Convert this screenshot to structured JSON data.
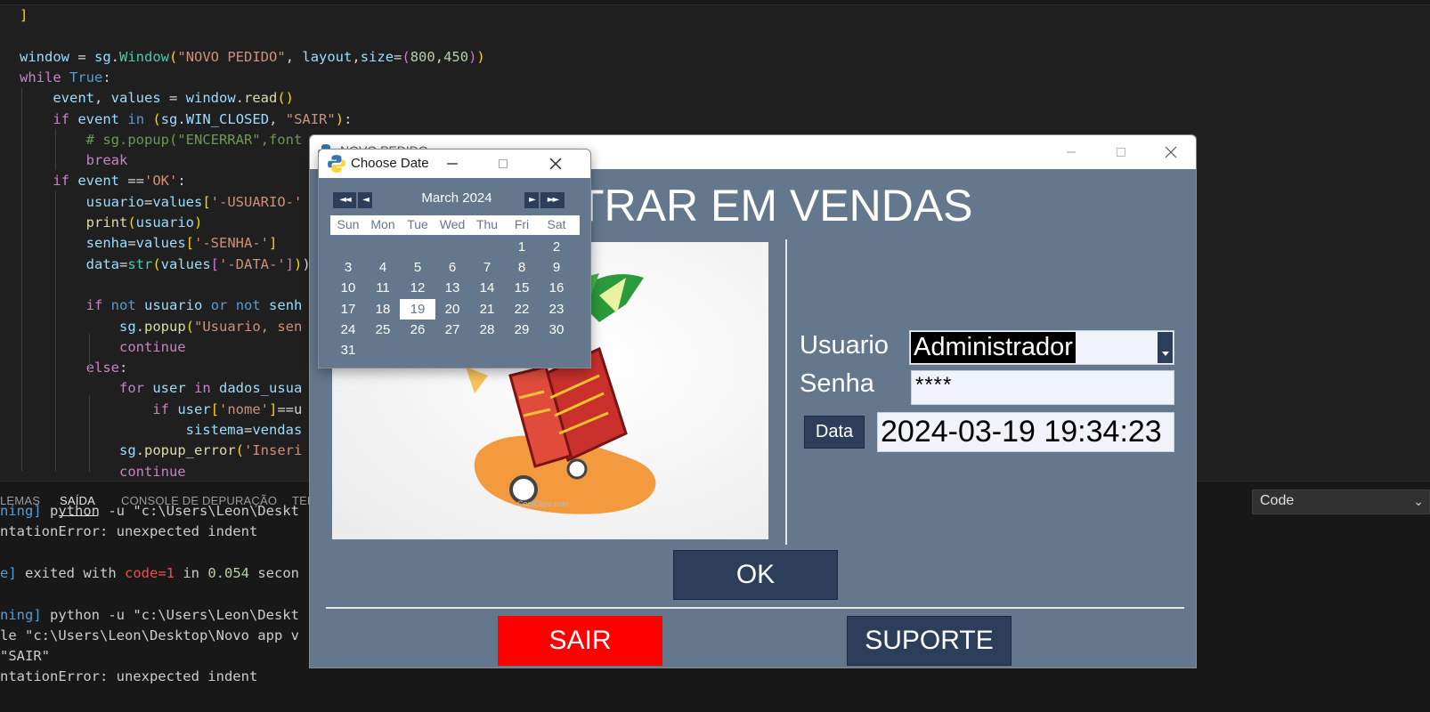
{
  "editor": {
    "lines": [
      [
        {
          "t": "]",
          "c": "tk-bracket"
        }
      ],
      [],
      [
        {
          "t": "window",
          "c": "tk-var"
        },
        {
          "t": " = ",
          "c": "tk-plain"
        },
        {
          "t": "sg",
          "c": "tk-var"
        },
        {
          "t": ".",
          "c": "tk-plain"
        },
        {
          "t": "Window",
          "c": "tk-cls"
        },
        {
          "t": "(",
          "c": "tk-bracket"
        },
        {
          "t": "\"NOVO PEDIDO\"",
          "c": "tk-str"
        },
        {
          "t": ", ",
          "c": "tk-plain"
        },
        {
          "t": "layout",
          "c": "tk-var"
        },
        {
          "t": ",",
          "c": "tk-plain"
        },
        {
          "t": "size",
          "c": "tk-var"
        },
        {
          "t": "=",
          "c": "tk-plain"
        },
        {
          "t": "(",
          "c": "tk-pink"
        },
        {
          "t": "800",
          "c": "tk-num"
        },
        {
          "t": ",",
          "c": "tk-plain"
        },
        {
          "t": "450",
          "c": "tk-num"
        },
        {
          "t": ")",
          "c": "tk-pink"
        },
        {
          "t": ")",
          "c": "tk-bracket"
        }
      ],
      [
        {
          "t": "while",
          "c": "tk-kw"
        },
        {
          "t": " ",
          "c": "tk-plain"
        },
        {
          "t": "True",
          "c": "tk-blue"
        },
        {
          "t": ":",
          "c": "tk-plain"
        }
      ],
      [
        {
          "t": "    event",
          "c": "tk-var"
        },
        {
          "t": ", ",
          "c": "tk-plain"
        },
        {
          "t": "values",
          "c": "tk-var"
        },
        {
          "t": " = ",
          "c": "tk-plain"
        },
        {
          "t": "window",
          "c": "tk-var"
        },
        {
          "t": ".",
          "c": "tk-plain"
        },
        {
          "t": "read",
          "c": "tk-fn"
        },
        {
          "t": "()",
          "c": "tk-bracket"
        }
      ],
      [
        {
          "t": "    if",
          "c": "tk-kw"
        },
        {
          "t": " ",
          "c": "tk-plain"
        },
        {
          "t": "event",
          "c": "tk-var"
        },
        {
          "t": " ",
          "c": "tk-plain"
        },
        {
          "t": "in",
          "c": "tk-blue"
        },
        {
          "t": " ",
          "c": "tk-plain"
        },
        {
          "t": "(",
          "c": "tk-bracket"
        },
        {
          "t": "sg",
          "c": "tk-var"
        },
        {
          "t": ".",
          "c": "tk-plain"
        },
        {
          "t": "WIN_CLOSED",
          "c": "tk-var"
        },
        {
          "t": ", ",
          "c": "tk-plain"
        },
        {
          "t": "\"SAIR\"",
          "c": "tk-str"
        },
        {
          "t": ")",
          "c": "tk-bracket"
        },
        {
          "t": ":",
          "c": "tk-plain"
        }
      ],
      [
        {
          "t": "        # sg.popup(\"ENCERRAR\",font",
          "c": "tk-cm"
        }
      ],
      [
        {
          "t": "        break",
          "c": "tk-kw"
        }
      ],
      [
        {
          "t": "    if",
          "c": "tk-kw"
        },
        {
          "t": " ",
          "c": "tk-plain"
        },
        {
          "t": "event",
          "c": "tk-var"
        },
        {
          "t": " ==",
          "c": "tk-plain"
        },
        {
          "t": "'OK'",
          "c": "tk-str"
        },
        {
          "t": ":",
          "c": "tk-plain"
        }
      ],
      [
        {
          "t": "        usuario",
          "c": "tk-var"
        },
        {
          "t": "=",
          "c": "tk-plain"
        },
        {
          "t": "values",
          "c": "tk-var"
        },
        {
          "t": "[",
          "c": "tk-bracket"
        },
        {
          "t": "'-USUARIO-'",
          "c": "tk-str"
        }
      ],
      [
        {
          "t": "        print",
          "c": "tk-fn"
        },
        {
          "t": "(",
          "c": "tk-bracket"
        },
        {
          "t": "usuario",
          "c": "tk-var"
        },
        {
          "t": ")",
          "c": "tk-bracket"
        }
      ],
      [
        {
          "t": "        senha",
          "c": "tk-var"
        },
        {
          "t": "=",
          "c": "tk-plain"
        },
        {
          "t": "values",
          "c": "tk-var"
        },
        {
          "t": "[",
          "c": "tk-bracket"
        },
        {
          "t": "'-SENHA-'",
          "c": "tk-str"
        },
        {
          "t": "]",
          "c": "tk-bracket"
        }
      ],
      [
        {
          "t": "        data",
          "c": "tk-var"
        },
        {
          "t": "=",
          "c": "tk-plain"
        },
        {
          "t": "str",
          "c": "tk-cls"
        },
        {
          "t": "(",
          "c": "tk-bracket"
        },
        {
          "t": "values",
          "c": "tk-var"
        },
        {
          "t": "[",
          "c": "tk-pink"
        },
        {
          "t": "'-DATA-'",
          "c": "tk-str"
        },
        {
          "t": "]",
          "c": "tk-pink"
        },
        {
          "t": ")",
          "c": "tk-bracket"
        },
        {
          "t": ")",
          "c": "tk-plain"
        }
      ],
      [],
      [
        {
          "t": "        if",
          "c": "tk-kw"
        },
        {
          "t": " ",
          "c": "tk-plain"
        },
        {
          "t": "not",
          "c": "tk-blue"
        },
        {
          "t": " ",
          "c": "tk-plain"
        },
        {
          "t": "usuario",
          "c": "tk-var"
        },
        {
          "t": " ",
          "c": "tk-plain"
        },
        {
          "t": "or",
          "c": "tk-blue"
        },
        {
          "t": " ",
          "c": "tk-plain"
        },
        {
          "t": "not",
          "c": "tk-blue"
        },
        {
          "t": " ",
          "c": "tk-plain"
        },
        {
          "t": "senh",
          "c": "tk-var"
        }
      ],
      [
        {
          "t": "            sg",
          "c": "tk-var"
        },
        {
          "t": ".",
          "c": "tk-plain"
        },
        {
          "t": "popup",
          "c": "tk-fn"
        },
        {
          "t": "(",
          "c": "tk-bracket"
        },
        {
          "t": "\"Usuario, sen",
          "c": "tk-str"
        }
      ],
      [
        {
          "t": "            continue",
          "c": "tk-kw"
        }
      ],
      [
        {
          "t": "        else",
          "c": "tk-kw"
        },
        {
          "t": ":",
          "c": "tk-plain"
        }
      ],
      [
        {
          "t": "            for",
          "c": "tk-kw"
        },
        {
          "t": " ",
          "c": "tk-plain"
        },
        {
          "t": "user",
          "c": "tk-var"
        },
        {
          "t": " ",
          "c": "tk-plain"
        },
        {
          "t": "in",
          "c": "tk-kw"
        },
        {
          "t": " ",
          "c": "tk-plain"
        },
        {
          "t": "dados_usua",
          "c": "tk-var"
        }
      ],
      [
        {
          "t": "                if",
          "c": "tk-kw"
        },
        {
          "t": " ",
          "c": "tk-plain"
        },
        {
          "t": "user",
          "c": "tk-var"
        },
        {
          "t": "[",
          "c": "tk-bracket"
        },
        {
          "t": "'nome'",
          "c": "tk-str"
        },
        {
          "t": "]",
          "c": "tk-bracket"
        },
        {
          "t": "==u",
          "c": "tk-plain"
        }
      ],
      [
        {
          "t": "                    sistema",
          "c": "tk-var"
        },
        {
          "t": "=",
          "c": "tk-plain"
        },
        {
          "t": "vendas",
          "c": "tk-var"
        }
      ],
      [
        {
          "t": "            sg",
          "c": "tk-var"
        },
        {
          "t": ".",
          "c": "tk-plain"
        },
        {
          "t": "popup_error",
          "c": "tk-fn"
        },
        {
          "t": "(",
          "c": "tk-bracket"
        },
        {
          "t": "'Inseri",
          "c": "tk-str"
        }
      ],
      [
        {
          "t": "            continue",
          "c": "tk-kw"
        }
      ]
    ]
  },
  "panel": {
    "tabs": [
      "LEMAS",
      "SAÍDA",
      "CONSOLE DE DEPURAÇÃO",
      "TER"
    ],
    "active_tab": "SAÍDA",
    "output": [
      [
        {
          "t": "ning]",
          "c": "out-blue"
        },
        {
          "t": " python -u \"c:\\Users\\Leon\\Deskt",
          "c": ""
        }
      ],
      [
        {
          "t": "ntationError: unexpected indent",
          "c": ""
        }
      ],
      [],
      [
        {
          "t": "e]",
          "c": "out-blue"
        },
        {
          "t": " exited with ",
          "c": ""
        },
        {
          "t": "code=1",
          "c": "out-red"
        },
        {
          "t": " in ",
          "c": ""
        },
        {
          "t": "0.054",
          "c": "out-num"
        },
        {
          "t": " secon",
          "c": ""
        }
      ],
      [],
      [
        {
          "t": "ning]",
          "c": "out-blue"
        },
        {
          "t": " python -u \"c:\\Users\\Leon\\Deskt",
          "c": ""
        }
      ],
      [
        {
          "t": "le \"c:\\Users\\Leon\\Desktop\\Novo app v",
          "c": ""
        }
      ],
      [
        {
          "t": "\"SAIR\"",
          "c": ""
        }
      ],
      [
        {
          "t": "ntationError: unexpected indent",
          "c": ""
        }
      ]
    ],
    "dropdown_value": "Code"
  },
  "main_window": {
    "title": "NOVO PEDIDO",
    "heading": "TRAR EM VENDAS",
    "usuario_label": "Usuario",
    "usuario_value": "Administrador",
    "senha_label": "Senha",
    "senha_value": "****",
    "data_button": "Data",
    "data_value": "2024-03-19 19:34:23",
    "ok_button": "OK",
    "sair_button": "SAIR",
    "suporte_button": "SUPORTE",
    "image_caption": "CoolClips.com",
    "colors": {
      "background": "#64778d",
      "button": "#2c3e5a",
      "exit": "#ff0000"
    }
  },
  "date_popup": {
    "title": "Choose Date",
    "month_label": "March 2024",
    "prev_year": "◄◄",
    "prev_month": "◄",
    "next_month": "►",
    "next_year": "►►",
    "weekdays": [
      "Sun",
      "Mon",
      "Tue",
      "Wed",
      "Thu",
      "Fri",
      "Sat"
    ],
    "first_weekday_index": 5,
    "days_in_month": 31,
    "selected_day": 19
  }
}
